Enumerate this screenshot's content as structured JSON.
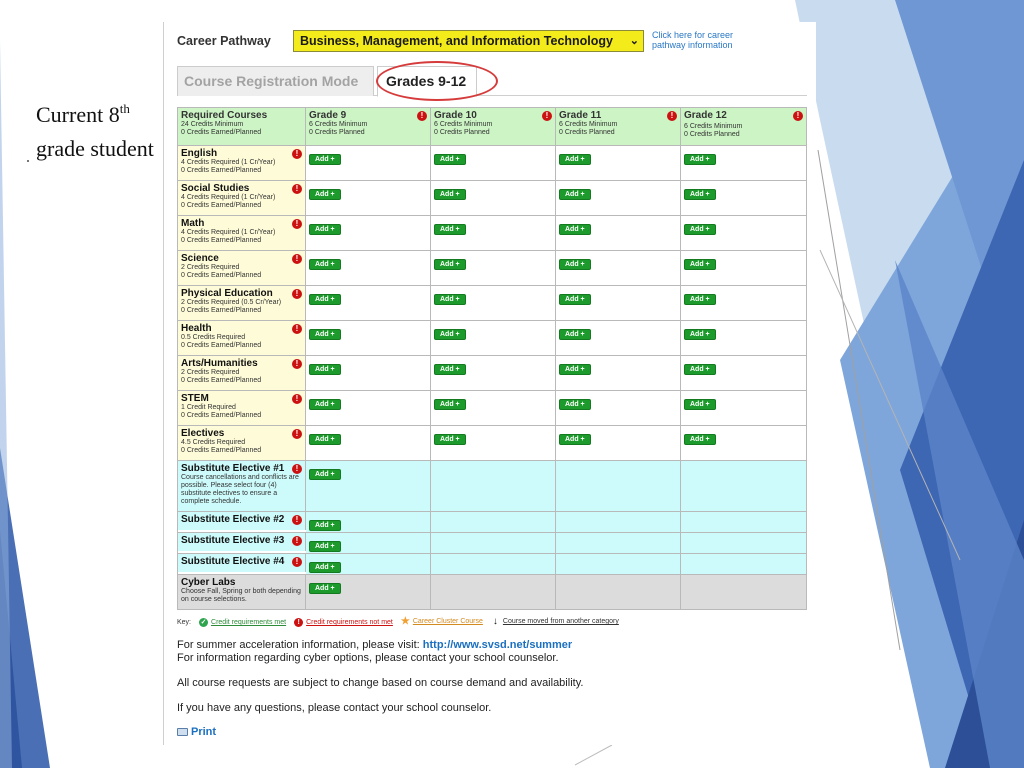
{
  "slide": {
    "title_main": "Current 8",
    "title_sup": "th",
    "title_rest": "grade student"
  },
  "pathway": {
    "label": "Career Pathway",
    "selected": "Business, Management, and Information Technology",
    "link": "Click here for career pathway information"
  },
  "tabs": {
    "mode": "Course Registration Mode",
    "grades": "Grades 9-12"
  },
  "header": {
    "requirements": {
      "title": "Required Courses",
      "line1": "24 Credits Minimum",
      "line2": "0 Credits Earned/Planned"
    },
    "grades": [
      {
        "title": "Grade 9",
        "line1": "6 Credits Minimum",
        "line2": "0 Credits Planned"
      },
      {
        "title": "Grade 10",
        "line1": "6 Credits Minimum",
        "line2": "0 Credits Planned"
      },
      {
        "title": "Grade 11",
        "line1": "6 Credits Minimum",
        "line2": "0 Credits Planned"
      },
      {
        "title": "Grade 12",
        "line1": "6 Credits Minimum",
        "line2": "0 Credits Planned"
      }
    ]
  },
  "add_label": "Add +",
  "warn_glyph": "!",
  "requirements": [
    {
      "title": "English",
      "line1": "4 Credits Required (1 Cr/Year)",
      "line2": "0 Credits Earned/Planned"
    },
    {
      "title": "Social Studies",
      "line1": "4 Credits Required (1 Cr/Year)",
      "line2": "0 Credits Earned/Planned"
    },
    {
      "title": "Math",
      "line1": "4 Credits Required (1 Cr/Year)",
      "line2": "0 Credits Earned/Planned"
    },
    {
      "title": "Science",
      "line1": "2 Credits Required",
      "line2": "0 Credits Earned/Planned"
    },
    {
      "title": "Physical Education",
      "line1": "2 Credits Required (0.5 Cr/Year)",
      "line2": "0 Credits Earned/Planned"
    },
    {
      "title": "Health",
      "line1": "0.5 Credits Required",
      "line2": "0 Credits Earned/Planned"
    },
    {
      "title": "Arts/Humanities",
      "line1": "2 Credits Required",
      "line2": "0 Credits Earned/Planned"
    },
    {
      "title": "STEM",
      "line1": "1 Credit Required",
      "line2": "0 Credits Earned/Planned"
    },
    {
      "title": "Electives",
      "line1": "4.5 Credits Required",
      "line2": "0 Credits Earned/Planned"
    }
  ],
  "substitutes": [
    {
      "title": "Substitute Elective #1",
      "note": "Course cancellations and conflicts are possible. Please select four (4) substitute electives to ensure a complete schedule."
    },
    {
      "title": "Substitute Elective #2"
    },
    {
      "title": "Substitute Elective #3"
    },
    {
      "title": "Substitute Elective #4"
    }
  ],
  "cyber": {
    "title": "Cyber Labs",
    "note": "Choose Fall, Spring or both depending on course selections."
  },
  "key": {
    "label": "Key:",
    "items": [
      {
        "icon": "check-circle-icon",
        "glyph": "✓",
        "color": "#2ea44f",
        "text": "Credit requirements met"
      },
      {
        "icon": "warning-circle-icon",
        "glyph": "!",
        "color": "#cc1111",
        "text": "Credit requirements not met"
      },
      {
        "icon": "star-icon",
        "glyph": "★",
        "color": "#f0a030",
        "text": "Career Cluster Course"
      },
      {
        "icon": "down-arrow-icon",
        "glyph": "↓",
        "color": "#111111",
        "text": "Course moved from another category"
      }
    ]
  },
  "notes": {
    "summer_prefix": "For summer acceleration information, please visit:",
    "summer_url": "http://www.svsd.net/summer",
    "cyber": "For information regarding cyber options, please contact your school counselor.",
    "change": "All course requests are subject to change based on course demand and availability.",
    "questions": "If you have any questions, please contact your school counselor."
  },
  "print_label": "Print",
  "colors": {
    "header_green": "#ccf4c4",
    "requirement_yellow": "#fefcd8",
    "substitute_cyan": "#cdfbfb",
    "cyber_gray": "#dcdcdc",
    "add_green": "#1c9a2b",
    "pathway_yellow": "#f4ec1a",
    "highlight_red": "#d63b3b",
    "slide_blue": "#4a72b8"
  }
}
